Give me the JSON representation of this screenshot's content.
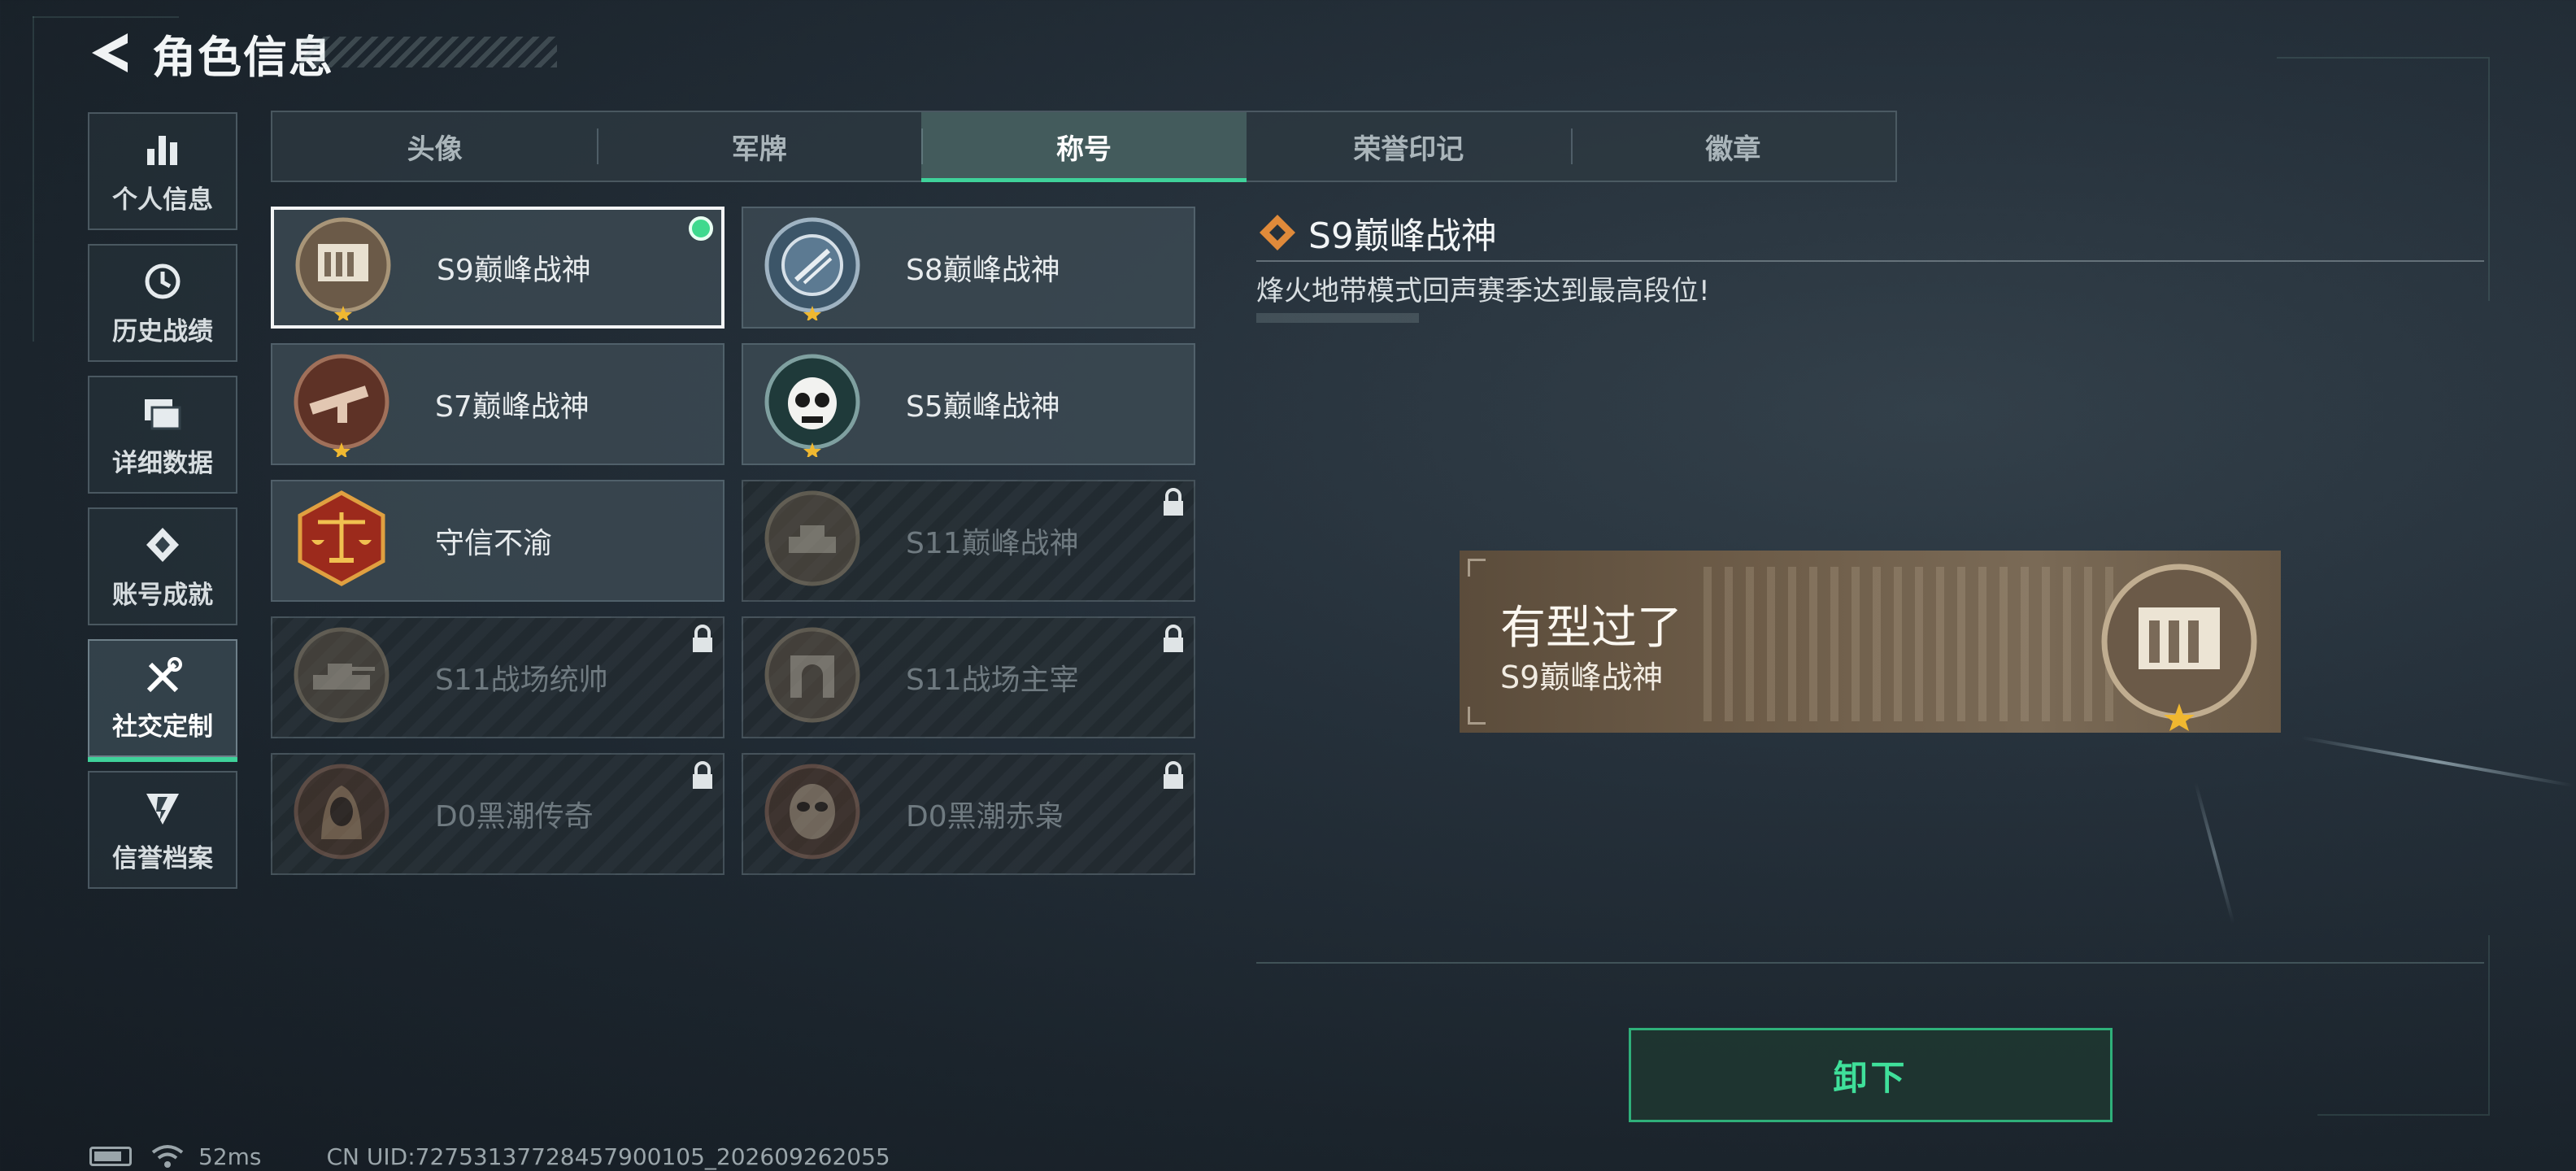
{
  "header": {
    "title": "角色信息"
  },
  "sidebar": {
    "items": [
      {
        "label": "个人信息",
        "icon": "bar-chart-icon"
      },
      {
        "label": "历史战绩",
        "icon": "history-icon"
      },
      {
        "label": "详细数据",
        "icon": "data-cards-icon"
      },
      {
        "label": "账号成就",
        "icon": "achievement-icon"
      },
      {
        "label": "社交定制",
        "icon": "tools-icon",
        "active": true
      },
      {
        "label": "信誉档案",
        "icon": "reputation-icon"
      }
    ]
  },
  "tabs": [
    {
      "label": "头像"
    },
    {
      "label": "军牌"
    },
    {
      "label": "称号",
      "active": true
    },
    {
      "label": "荣誉印记"
    },
    {
      "label": "徽章"
    }
  ],
  "titles": [
    {
      "name": "S9巅峰战神",
      "locked": false,
      "selected": true,
      "equipped": true
    },
    {
      "name": "S8巅峰战神",
      "locked": false
    },
    {
      "name": "S7巅峰战神",
      "locked": false
    },
    {
      "name": "S5巅峰战神",
      "locked": false
    },
    {
      "name": "守信不渝",
      "locked": false
    },
    {
      "name": "S11巅峰战神",
      "locked": true
    },
    {
      "name": "S11战场统帅",
      "locked": true
    },
    {
      "name": "S11战场主宰",
      "locked": true
    },
    {
      "name": "D0黑潮传奇",
      "locked": true
    },
    {
      "name": "D0黑潮赤枭",
      "locked": true
    }
  ],
  "detail": {
    "title": "S9巅峰战神",
    "description": "烽火地带模式回声赛季达到最高段位!",
    "nameplate": {
      "main": "有型过了",
      "sub": "S9巅峰战神"
    },
    "button": "卸下"
  },
  "status": {
    "ping": "52ms",
    "uid": "CN UID:727531377284579001​05_202609262055"
  },
  "colors": {
    "accent": "#3fd29a",
    "equipped": "#3fd98e",
    "nameplate": "#6d5c48"
  }
}
